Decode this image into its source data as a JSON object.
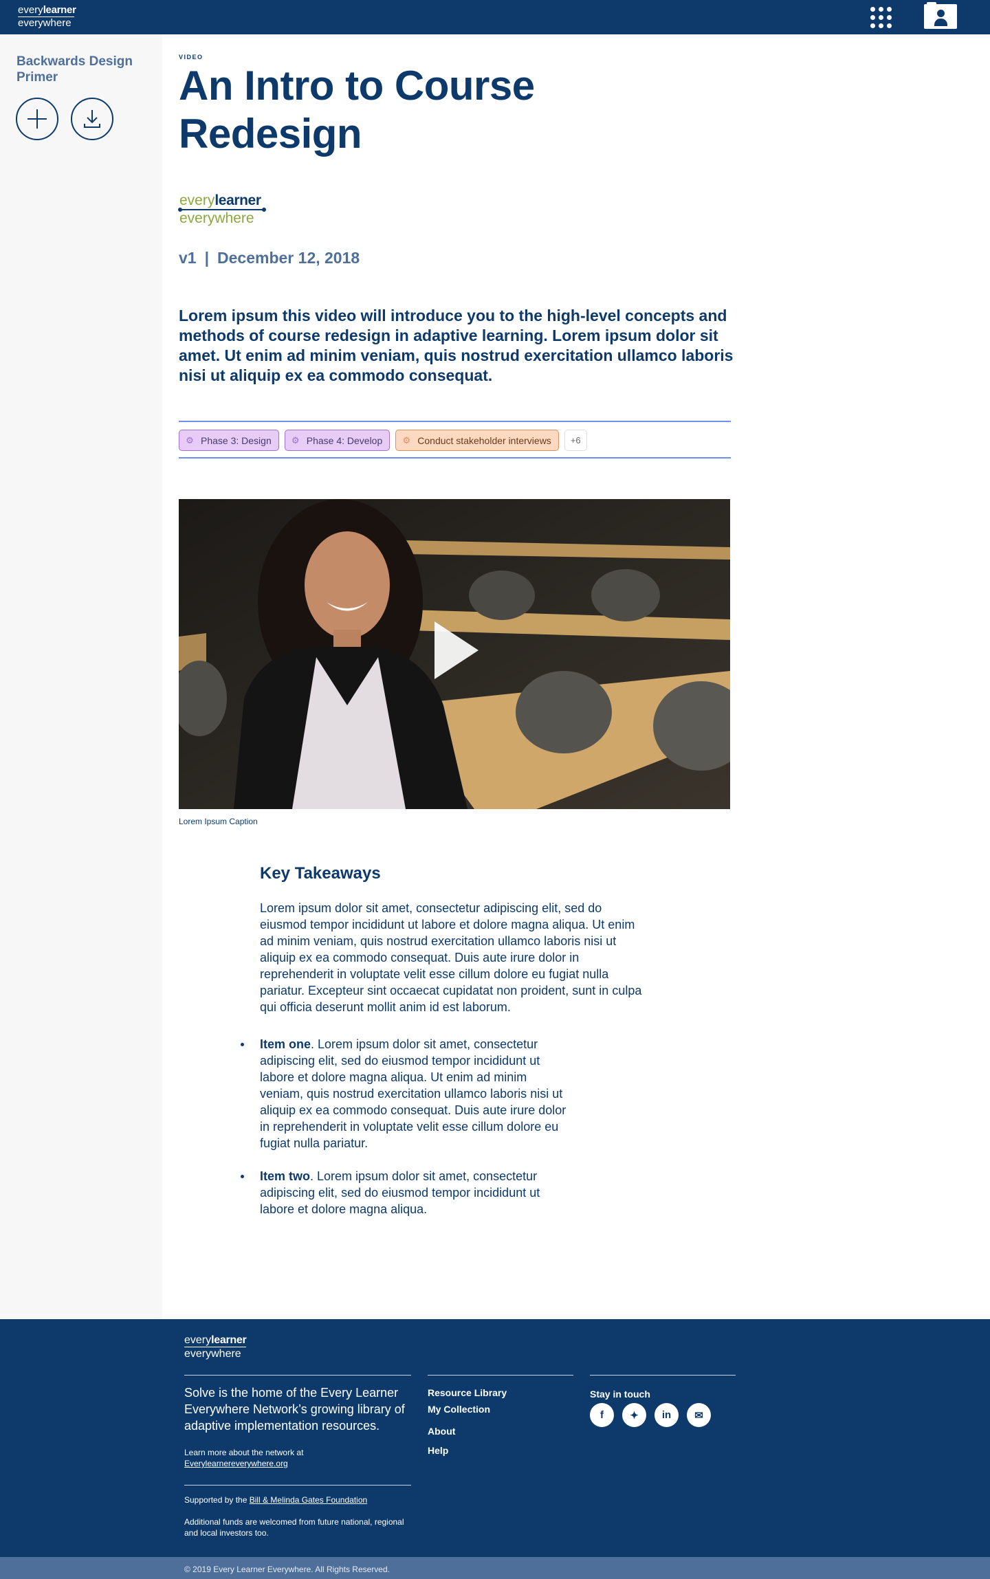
{
  "header": {
    "logo_top_every": "every",
    "logo_top_learner": "learner",
    "logo_bottom": "everywhere"
  },
  "sidebar": {
    "collection_title": "Backwards Design Primer",
    "add_icon": "plus-icon",
    "download_icon": "download-icon"
  },
  "article": {
    "eyebrow": "VIDEO",
    "title": "An Intro to Course Redesign",
    "brand_every": "every",
    "brand_learner": "learner",
    "brand_everywhere": "everywhere",
    "version": "v1",
    "separator": "|",
    "date": "December 12, 2018",
    "lede": "Lorem ipsum this video will introduce you to the high-level concepts and methods of course redesign in adaptive learning. Lorem ipsum dolor sit amet. Ut enim ad minim veniam, quis nostrud exercitation ullamco laboris nisi ut aliquip ex ea commodo consequat.",
    "tags": [
      {
        "label": "Phase 3: Design",
        "color": "#e6ccf7"
      },
      {
        "label": "Phase 4: Develop",
        "color": "#e6ccf7"
      },
      {
        "label": "Conduct stakeholder interviews",
        "color": "#fcd9c0"
      }
    ],
    "tags_more": "+6",
    "video_caption": "Lorem Ipsum Caption"
  },
  "takeaways": {
    "title": "Key Takeaways",
    "body": "Lorem ipsum dolor sit amet, consectetur adipiscing elit, sed do eiusmod tempor incididunt ut labore et dolore magna aliqua. Ut enim ad minim veniam, quis nostrud exercitation ullamco laboris nisi ut aliquip ex ea commodo consequat. Duis aute irure dolor in reprehenderit in voluptate velit esse cillum dolore eu fugiat nulla pariatur. Excepteur sint occaecat cupidatat non proident, sunt in culpa qui officia deserunt mollit anim id est laborum.",
    "items": [
      {
        "lead": "Item one",
        "text": ". Lorem ipsum dolor sit amet, consectetur adipiscing elit, sed do eiusmod tempor incididunt ut labore et dolore magna aliqua. Ut enim ad minim veniam, quis nostrud exercitation ullamco laboris nisi ut aliquip ex ea commodo consequat. Duis aute irure dolor in reprehenderit in voluptate velit esse cillum dolore eu fugiat nulla pariatur."
      },
      {
        "lead": "Item two",
        "text": ". Lorem ipsum dolor sit amet, consectetur adipiscing elit, sed do eiusmod tempor incididunt ut labore et dolore magna aliqua."
      }
    ]
  },
  "footer": {
    "logo_every": "every",
    "logo_learner": "learner",
    "logo_everywhere": "everywhere",
    "about": "Solve is the home of the Every Learner Everywhere Network’s growing library of adaptive implementation resources.",
    "learn_more": "Learn more about the network at",
    "learn_more_link": "Everylearnereverywhere.org",
    "supported_by": "Supported by the",
    "supported_link": "Bill & Melinda Gates Foundation",
    "additional": "Additional funds are welcomed from future national, regional and local investors too.",
    "nav": [
      "Resource Library",
      "My Collection",
      "About",
      "Help"
    ],
    "stay_in_touch": "Stay in touch",
    "social": [
      "facebook-icon",
      "twitter-icon",
      "linkedin-icon",
      "email-icon"
    ],
    "copyright": "© 2019 Every Learner Everywhere. All Rights Reserved."
  }
}
